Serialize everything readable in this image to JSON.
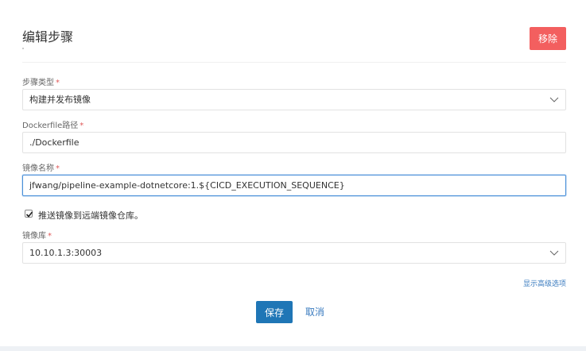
{
  "dialog": {
    "title": "编辑步骤",
    "remove_label": "移除"
  },
  "form": {
    "step_type": {
      "label": "步骤类型",
      "required_mark": "*",
      "value": "构建并发布镜像"
    },
    "dockerfile_path": {
      "label": "Dockerfile路径",
      "required_mark": "*",
      "value": "./Dockerfile"
    },
    "image_name": {
      "label": "镜像名称",
      "required_mark": "*",
      "value": "jfwang/pipeline-example-dotnetcore:1.${CICD_EXECUTION_SEQUENCE}"
    },
    "push_remote": {
      "label": "推送镜像到远端镜像仓库。",
      "checked": true
    },
    "registry": {
      "label": "镜像库",
      "required_mark": "*",
      "value": "10.10.1.3:30003"
    },
    "advanced_link": "显示高级选项"
  },
  "actions": {
    "save_label": "保存",
    "cancel_label": "取消"
  },
  "colors": {
    "remove": "#f35f5f",
    "primary": "#1f76b6",
    "link": "#3a7bbf",
    "required": "#e05a5a",
    "focus_border": "#4a90d9"
  },
  "icons": {
    "select_arrow": "chevron-down-icon",
    "checkbox_mark": "check-icon"
  }
}
